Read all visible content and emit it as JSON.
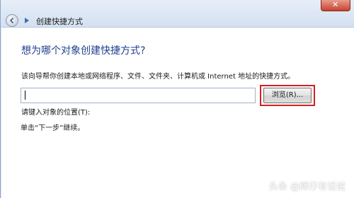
{
  "nav": {
    "title": "创建快捷方式"
  },
  "heading": "想为哪个对象创建快捷方式?",
  "description": "该向导帮你创建本地或网络程序、文件、文件夹、计算机或 Internet 地址的快捷方式。",
  "location": {
    "label": "请键入对象的位置(T):",
    "value": "",
    "placeholder": ""
  },
  "browse_label": "浏览(R)...",
  "continue_hint": "单击“下一步”继续。",
  "watermark": "头条 @辉仔有话说",
  "colors": {
    "heading": "#1e3f8f",
    "highlight": "#d2211f",
    "close_button": "#c6432f"
  }
}
